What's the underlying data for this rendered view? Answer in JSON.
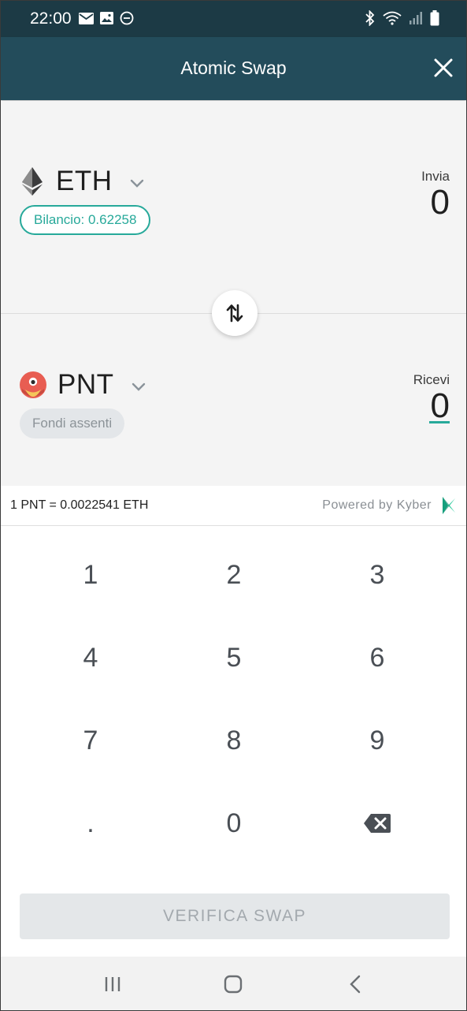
{
  "status_bar": {
    "time": "22:00",
    "left_icons": [
      "mail-icon",
      "image-icon",
      "do-not-disturb-icon"
    ],
    "right_icons": [
      "bluetooth-icon",
      "wifi-icon",
      "signal-icon",
      "battery-icon"
    ]
  },
  "header": {
    "title": "Atomic Swap",
    "close_icon": "close-icon"
  },
  "send": {
    "token_symbol": "ETH",
    "token_icon": "ethereum-icon",
    "balance_label": "Bilancio: 0.62258",
    "amount_label": "Invia",
    "amount": "0"
  },
  "receive": {
    "token_symbol": "PNT",
    "token_icon": "pnt-icon",
    "funds_label": "Fondi assenti",
    "amount_label": "Ricevi",
    "amount": "0"
  },
  "swap_direction_icon": "swap-arrows-icon",
  "rate": {
    "text": "1 PNT = 0.0022541 ETH",
    "powered_by": "Powered by Kyber",
    "provider_icon": "kyber-icon"
  },
  "keypad": {
    "keys": [
      "1",
      "2",
      "3",
      "4",
      "5",
      "6",
      "7",
      "8",
      "9",
      ".",
      "0"
    ],
    "backspace_icon": "backspace-icon"
  },
  "verify_button": {
    "label": "VERIFICA SWAP"
  },
  "nav": {
    "recents_icon": "recents-icon",
    "home_icon": "home-icon",
    "back_icon": "back-icon"
  },
  "colors": {
    "status_bar": "#1c3a45",
    "header": "#234c5b",
    "accent": "#27a99a",
    "swap_area": "#f4f4f4"
  }
}
